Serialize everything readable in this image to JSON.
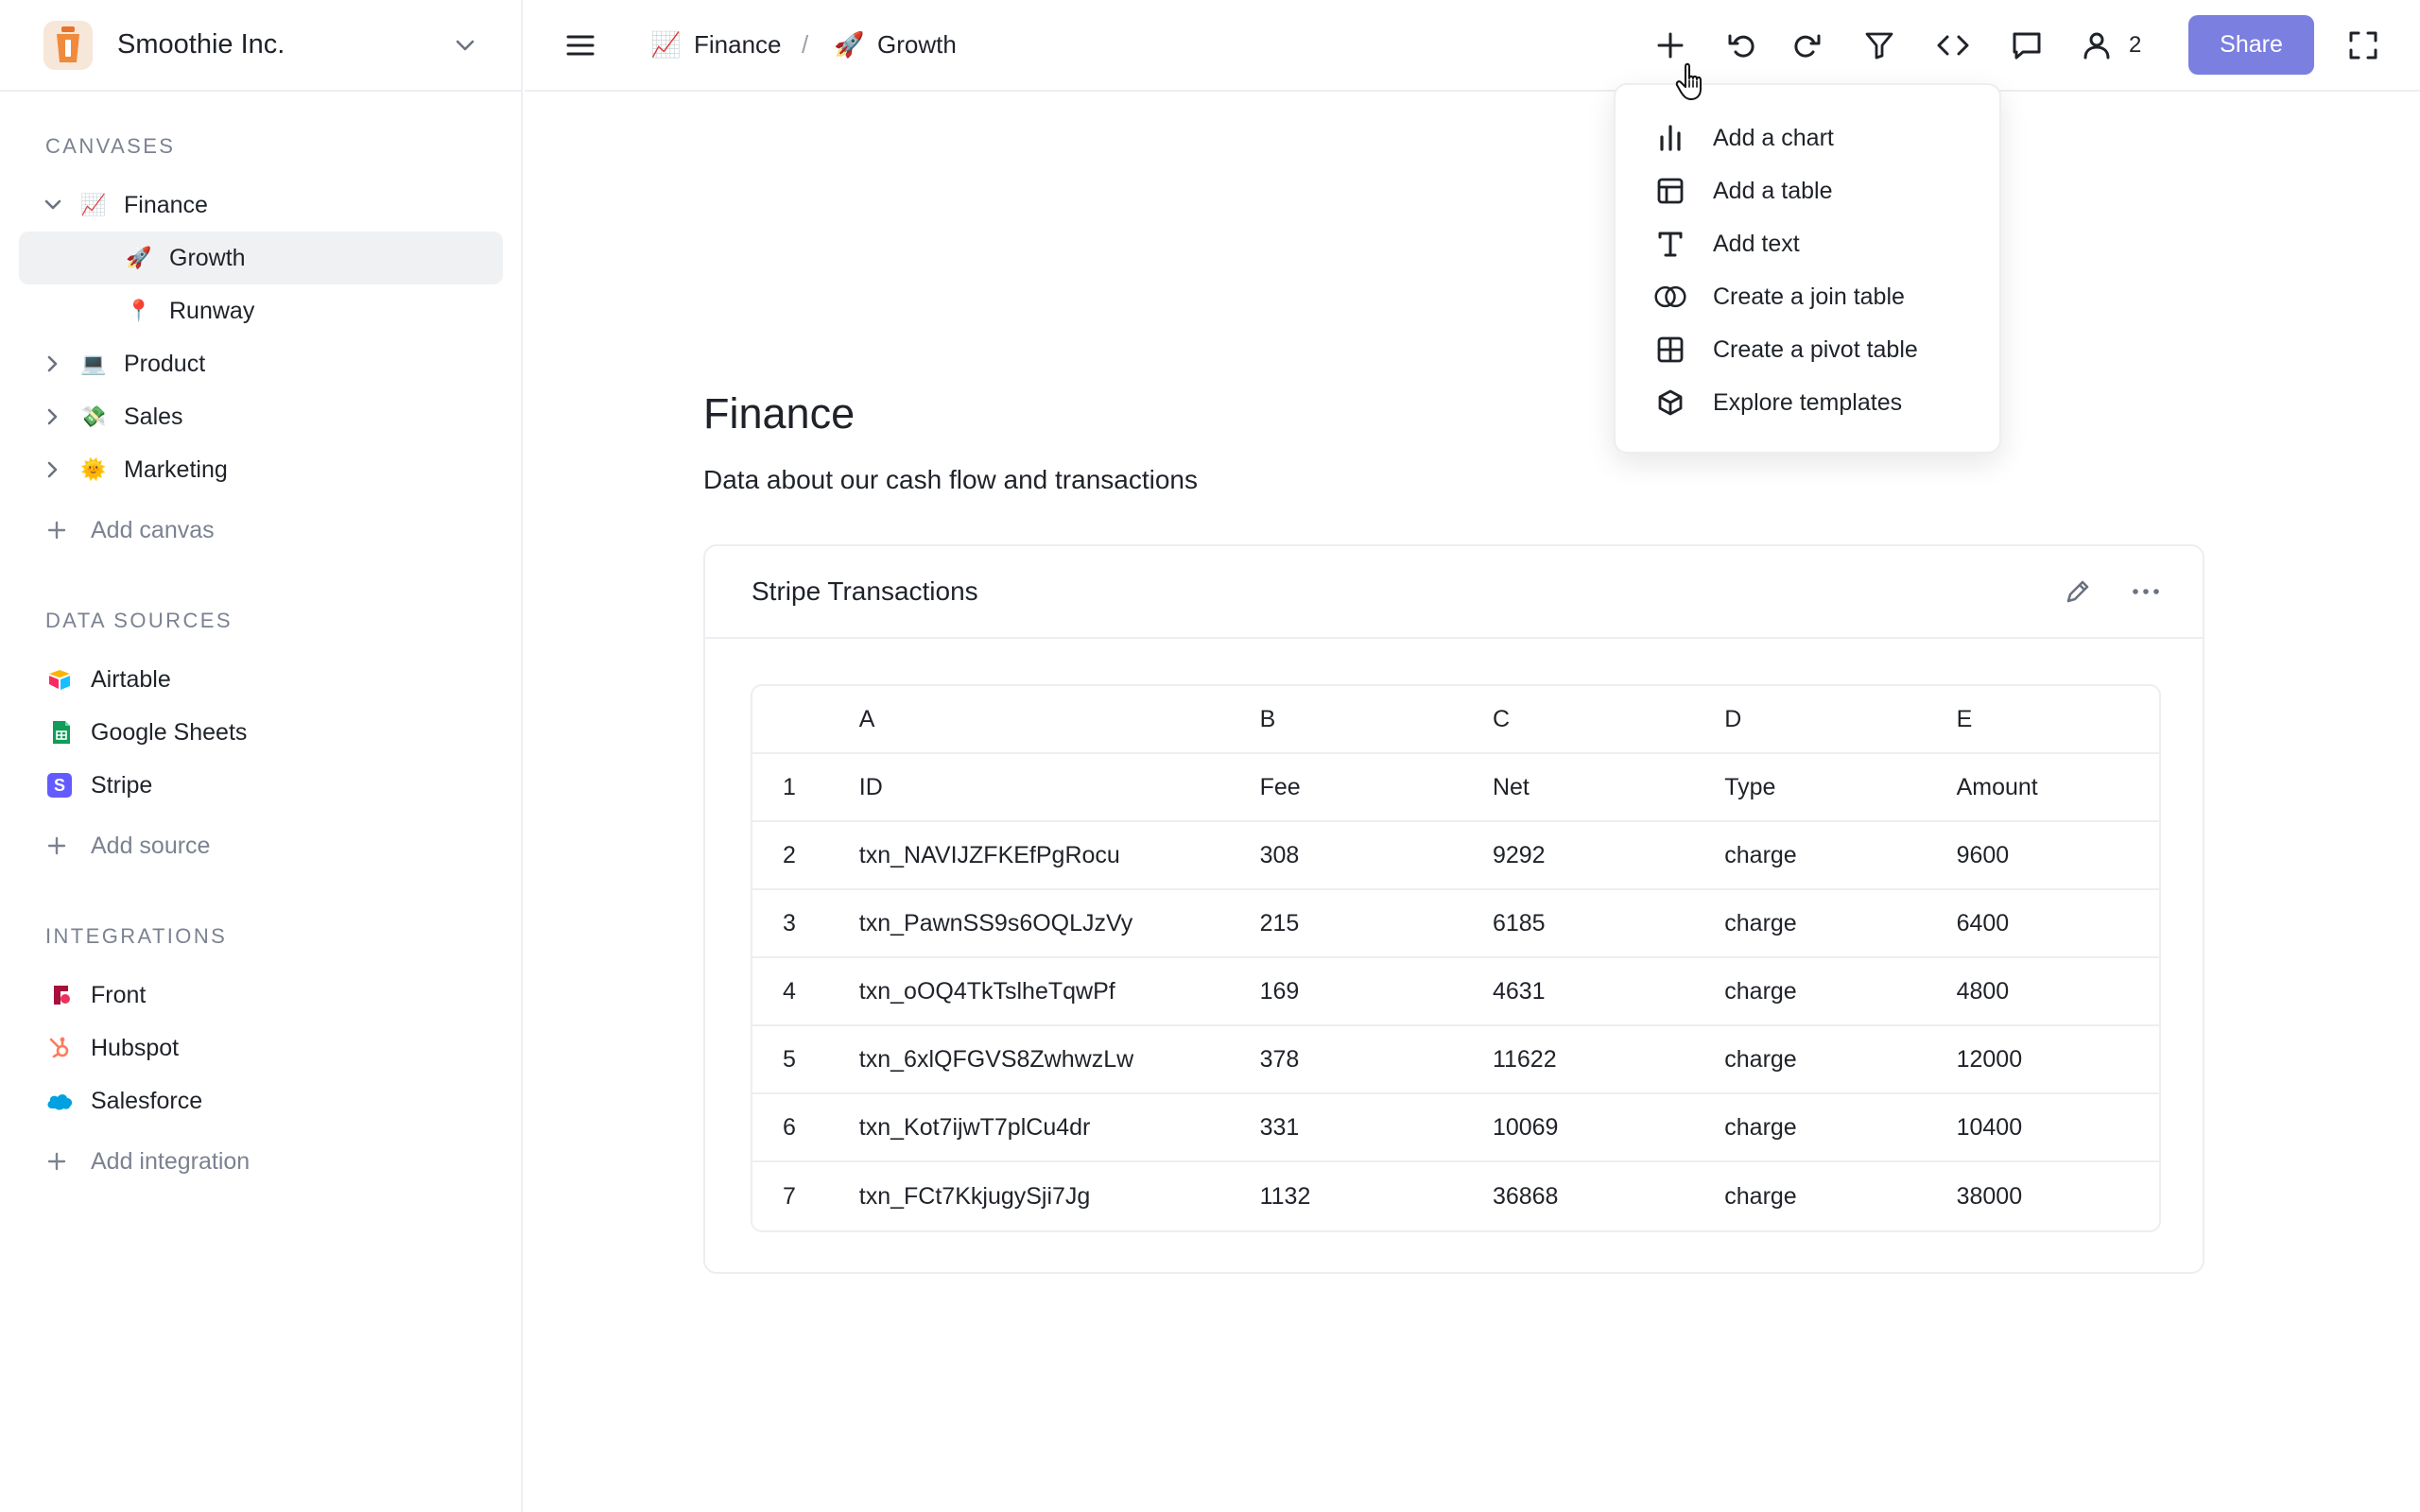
{
  "workspace": {
    "name": "Smoothie Inc."
  },
  "sidebar": {
    "canvases_label": "CANVASES",
    "canvases": [
      {
        "label": "Finance",
        "emoji": "📈",
        "expanded": true
      },
      {
        "label": "Growth",
        "emoji": "🚀",
        "active": true
      },
      {
        "label": "Runway",
        "emoji": "📍"
      },
      {
        "label": "Product",
        "emoji": "💻"
      },
      {
        "label": "Sales",
        "emoji": "💸"
      },
      {
        "label": "Marketing",
        "emoji": "🌞"
      }
    ],
    "add_canvas": "Add canvas",
    "sources_label": "DATA SOURCES",
    "sources": [
      {
        "label": "Airtable",
        "icon": "airtable-icon"
      },
      {
        "label": "Google Sheets",
        "icon": "google-sheets-icon"
      },
      {
        "label": "Stripe",
        "icon": "stripe-icon"
      }
    ],
    "add_source": "Add source",
    "integrations_label": "INTEGRATIONS",
    "integrations": [
      {
        "label": "Front",
        "icon": "front-icon"
      },
      {
        "label": "Hubspot",
        "icon": "hubspot-icon"
      },
      {
        "label": "Salesforce",
        "icon": "salesforce-icon"
      }
    ],
    "add_integration": "Add integration"
  },
  "breadcrumb": [
    {
      "label": "Finance",
      "emoji": "📈"
    },
    {
      "label": "Growth",
      "emoji": "🚀"
    }
  ],
  "breadcrumb_separator": "/",
  "toolbar": {
    "collaborator_count": "2",
    "share_label": "Share"
  },
  "add_menu": [
    {
      "label": "Add a chart",
      "icon": "bar-chart-icon"
    },
    {
      "label": "Add a table",
      "icon": "table-icon"
    },
    {
      "label": "Add text",
      "icon": "text-icon"
    },
    {
      "label": "Create a join table",
      "icon": "join-icon"
    },
    {
      "label": "Create a pivot table",
      "icon": "pivot-table-icon"
    },
    {
      "label": "Explore templates",
      "icon": "cube-icon"
    }
  ],
  "page": {
    "title": "Finance",
    "description": "Data about our cash flow and transactions"
  },
  "card": {
    "title": "Stripe Transactions",
    "column_letters": [
      "A",
      "B",
      "C",
      "D",
      "E"
    ],
    "rows": [
      [
        "1",
        "ID",
        "Fee",
        "Net",
        "Type",
        "Amount"
      ],
      [
        "2",
        "txn_NAVIJZFKEfPgRocu",
        "308",
        "9292",
        "charge",
        "9600"
      ],
      [
        "3",
        "txn_PawnSS9s6OQLJzVy",
        "215",
        "6185",
        "charge",
        "6400"
      ],
      [
        "4",
        "txn_oOQ4TkTslheTqwPf",
        "169",
        "4631",
        "charge",
        "4800"
      ],
      [
        "5",
        "txn_6xlQFGVS8ZwhwzLw",
        "378",
        "11622",
        "charge",
        "12000"
      ],
      [
        "6",
        "txn_Kot7ijwT7plCu4dr",
        "331",
        "10069",
        "charge",
        "10400"
      ],
      [
        "7",
        "txn_FCt7KkjugySji7Jg",
        "1132",
        "36868",
        "charge",
        "38000"
      ]
    ]
  },
  "colors": {
    "accent": "#7b7fe0",
    "border": "#eceef1",
    "muted": "#7b8290",
    "active_bg": "#f0f1f3"
  }
}
